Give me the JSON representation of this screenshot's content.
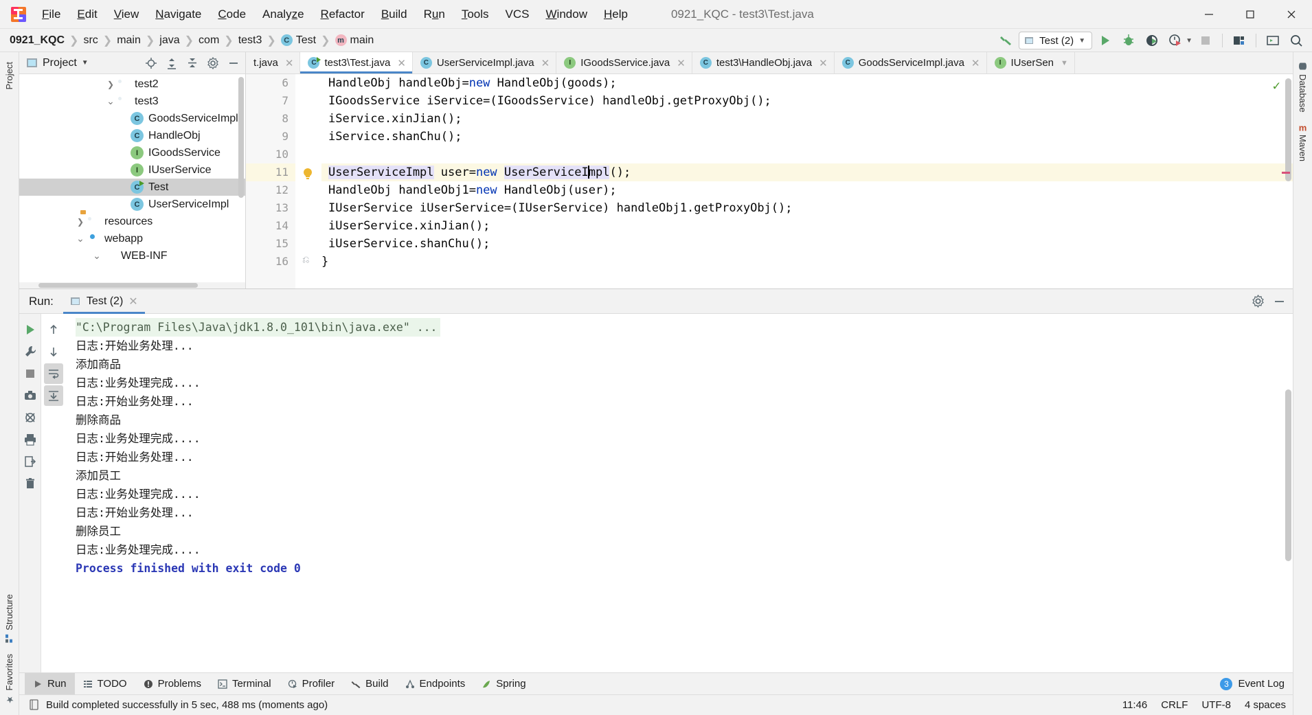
{
  "window": {
    "title": "0921_KQC - test3\\Test.java",
    "minimize": "minimize-icon",
    "maximize": "maximize-icon",
    "close": "close-icon"
  },
  "menubar": {
    "items": [
      {
        "label": "File",
        "mnemonic": "F"
      },
      {
        "label": "Edit",
        "mnemonic": "E"
      },
      {
        "label": "View",
        "mnemonic": "V"
      },
      {
        "label": "Navigate",
        "mnemonic": "N"
      },
      {
        "label": "Code",
        "mnemonic": "C"
      },
      {
        "label": "Analyze",
        "mnemonic": "z"
      },
      {
        "label": "Refactor",
        "mnemonic": "R"
      },
      {
        "label": "Build",
        "mnemonic": "B"
      },
      {
        "label": "Run",
        "mnemonic": "u"
      },
      {
        "label": "Tools",
        "mnemonic": "T"
      },
      {
        "label": "VCS",
        "mnemonic": ""
      },
      {
        "label": "Window",
        "mnemonic": "W"
      },
      {
        "label": "Help",
        "mnemonic": "H"
      }
    ]
  },
  "navbar": {
    "crumbs": [
      {
        "label": "0921_KQC",
        "icon": ""
      },
      {
        "label": "src",
        "icon": ""
      },
      {
        "label": "main",
        "icon": ""
      },
      {
        "label": "java",
        "icon": ""
      },
      {
        "label": "com",
        "icon": ""
      },
      {
        "label": "test3",
        "icon": ""
      },
      {
        "label": "Test",
        "icon": "class-icon"
      },
      {
        "label": "main",
        "icon": "method-icon"
      }
    ],
    "run_config": "Test (2)",
    "buttons": [
      {
        "name": "build-hammer-icon"
      },
      {
        "name": "run-button"
      },
      {
        "name": "debug-button"
      },
      {
        "name": "run-with-coverage-button"
      },
      {
        "name": "profiler-button"
      },
      {
        "name": "stop-button"
      },
      {
        "name": "project-structure-button"
      },
      {
        "name": "console-button"
      },
      {
        "name": "search-everywhere-button"
      }
    ]
  },
  "left_rail": {
    "top": "Project",
    "bottom": [
      "Structure",
      "Favorites"
    ]
  },
  "right_rail": {
    "items": [
      "Database",
      "Maven"
    ]
  },
  "project_panel": {
    "title": "Project",
    "tools": [
      "locate-icon",
      "expand-all-icon",
      "collapse-all-icon",
      "settings-icon",
      "hide-icon"
    ],
    "tree": [
      {
        "label": "test2",
        "arrow": "›",
        "icon": "folder",
        "indent": 152,
        "selected": false
      },
      {
        "label": "test3",
        "arrow": "⌄",
        "icon": "folder",
        "indent": 152,
        "selected": false
      },
      {
        "label": "GoodsServiceImpl",
        "arrow": "",
        "icon": "class",
        "indent": 190,
        "selected": false
      },
      {
        "label": "HandleObj",
        "arrow": "",
        "icon": "class",
        "indent": 190,
        "selected": false
      },
      {
        "label": "IGoodsService",
        "arrow": "",
        "icon": "interface",
        "indent": 190,
        "selected": false
      },
      {
        "label": "IUserService",
        "arrow": "",
        "icon": "interface",
        "indent": 190,
        "selected": false
      },
      {
        "label": "Test",
        "arrow": "",
        "icon": "class-runnable",
        "indent": 190,
        "selected": true
      },
      {
        "label": "UserServiceImpl",
        "arrow": "",
        "icon": "class",
        "indent": 190,
        "selected": false
      },
      {
        "label": "resources",
        "arrow": "›",
        "icon": "folder-resources",
        "indent": 108,
        "selected": false
      },
      {
        "label": "webapp",
        "arrow": "⌄",
        "icon": "webapp",
        "indent": 108,
        "selected": false
      },
      {
        "label": "WEB-INF",
        "arrow": "⌄",
        "icon": "folder-plain",
        "indent": 130,
        "selected": false
      }
    ]
  },
  "editor": {
    "tabs": [
      {
        "label": "t.java",
        "icon": "",
        "active": false,
        "closable": true
      },
      {
        "label": "test3\\Test.java",
        "icon": "class-runnable",
        "active": true,
        "closable": true
      },
      {
        "label": "UserServiceImpl.java",
        "icon": "class",
        "active": false,
        "closable": true
      },
      {
        "label": "IGoodsService.java",
        "icon": "interface",
        "active": false,
        "closable": true
      },
      {
        "label": "test3\\HandleObj.java",
        "icon": "class",
        "active": false,
        "closable": true
      },
      {
        "label": "GoodsServiceImpl.java",
        "icon": "class",
        "active": false,
        "closable": true
      },
      {
        "label": "IUserSen",
        "icon": "interface",
        "active": false,
        "closable": false
      }
    ],
    "lines": [
      {
        "no": "6",
        "text": "HandleObj handleObj=new HandleObj(goods);"
      },
      {
        "no": "7",
        "text": "IGoodsService iService=(IGoodsService) handleObj.getProxyObj();"
      },
      {
        "no": "8",
        "text": "iService.xinJian();"
      },
      {
        "no": "9",
        "text": "iService.shanChu();"
      },
      {
        "no": "10",
        "text": ""
      },
      {
        "no": "11",
        "text": "UserServiceImpl user=new UserServiceImpl();"
      },
      {
        "no": "12",
        "text": "HandleObj handleObj1=new HandleObj(user);"
      },
      {
        "no": "13",
        "text": "IUserService iUserService=(IUserService) handleObj1.getProxyObj();"
      },
      {
        "no": "14",
        "text": "iUserService.xinJian();"
      },
      {
        "no": "15",
        "text": "iUserService.shanChu();"
      },
      {
        "no": "16",
        "text": "}"
      }
    ],
    "caret_line": "11",
    "inspection_status": "ok"
  },
  "run_window": {
    "label": "Run:",
    "tab": "Test (2)",
    "left_tools": [
      "rerun-icon",
      "wrench-icon",
      "stop-icon",
      "camera-icon",
      "mute-icon",
      "print-icon",
      "export-icon",
      "trash-icon"
    ],
    "nav_tools": [
      "up-icon",
      "down-icon",
      "soft-wrap-icon",
      "scroll-to-end-icon"
    ],
    "settings_icon": "gear-icon",
    "hide_icon": "minimize-icon",
    "console": [
      {
        "text": "\"C:\\Program Files\\Java\\jdk1.8.0_101\\bin\\java.exe\" ...",
        "style": "cmd"
      },
      {
        "text": "日志:开始业务处理...",
        "style": "plain"
      },
      {
        "text": "添加商品",
        "style": "plain"
      },
      {
        "text": "日志:业务处理完成....",
        "style": "plain"
      },
      {
        "text": "日志:开始业务处理...",
        "style": "plain"
      },
      {
        "text": "删除商品",
        "style": "plain"
      },
      {
        "text": "日志:业务处理完成....",
        "style": "plain"
      },
      {
        "text": "日志:开始业务处理...",
        "style": "plain"
      },
      {
        "text": "添加员工",
        "style": "plain"
      },
      {
        "text": "日志:业务处理完成....",
        "style": "plain"
      },
      {
        "text": "日志:开始业务处理...",
        "style": "plain"
      },
      {
        "text": "删除员工",
        "style": "plain"
      },
      {
        "text": "日志:业务处理完成....",
        "style": "plain"
      },
      {
        "text": "",
        "style": "plain"
      },
      {
        "text": "Process finished with exit code 0",
        "style": "done"
      }
    ]
  },
  "toolwindow_bar": {
    "items": [
      {
        "label": "Run",
        "icon": "run-icon",
        "active": true
      },
      {
        "label": "TODO",
        "icon": "todo-icon",
        "active": false
      },
      {
        "label": "Problems",
        "icon": "problems-icon",
        "active": false
      },
      {
        "label": "Terminal",
        "icon": "terminal-icon",
        "active": false
      },
      {
        "label": "Profiler",
        "icon": "profiler-icon",
        "active": false
      },
      {
        "label": "Build",
        "icon": "build-icon",
        "active": false
      },
      {
        "label": "Endpoints",
        "icon": "endpoints-icon",
        "active": false
      },
      {
        "label": "Spring",
        "icon": "spring-icon",
        "active": false
      }
    ],
    "event_log": "Event Log",
    "event_log_count": "3"
  },
  "statusbar": {
    "message": "Build completed successfully in 5 sec, 488 ms (moments ago)",
    "time": "11:46",
    "line_separator": "CRLF",
    "encoding": "UTF-8",
    "indent": "4 spaces"
  },
  "colors": {
    "accent": "#4a86c8",
    "run_green": "#4c9a2a",
    "class_icon": "#7cc6e0",
    "interface_icon": "#8cc97f",
    "caret_line": "#fcf8e3",
    "selection": "#d0d0d0"
  }
}
